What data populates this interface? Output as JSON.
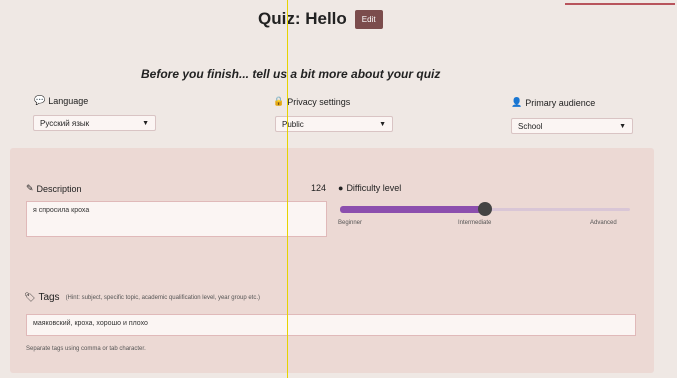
{
  "header": {
    "title": "Quiz: Hello",
    "edit_label": "Edit"
  },
  "subtitle": "Before you finish... tell us a bit more about your quiz",
  "language": {
    "label": "Language",
    "value": "Русский язык"
  },
  "privacy": {
    "label": "Privacy settings",
    "value": "Public"
  },
  "audience": {
    "label": "Primary audience",
    "value": "School"
  },
  "description": {
    "label": "Description",
    "count": "124",
    "value": "я спросила кроха"
  },
  "difficulty": {
    "label": "Difficulty level",
    "level": 0.5,
    "ticks": [
      "Beginner",
      "Intermediate",
      "Advanced"
    ]
  },
  "tags": {
    "label": "Tags",
    "hint": "(Hint: subject, specific topic, academic qualification level, year group etc.)",
    "value": "маяковский, кроха, хорошо и плохо",
    "help": "Separate tags using comma or tab character."
  },
  "colors": {
    "accent": "#8c4fae",
    "edit_button": "#7b4c4c"
  }
}
